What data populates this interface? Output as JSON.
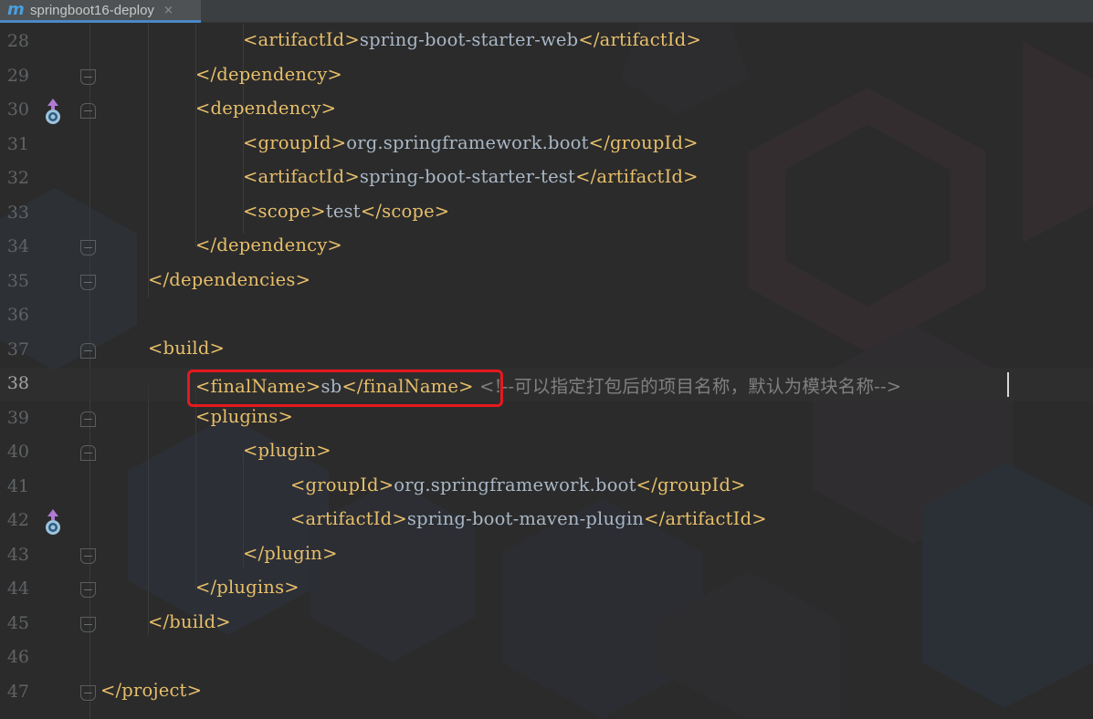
{
  "tab": {
    "icon": "m",
    "title": "springboot16-deploy",
    "close": "×"
  },
  "lines": [
    {
      "num": "28",
      "indent": 3,
      "tokens": [
        [
          "tag",
          "<artifactId>"
        ],
        [
          "txt",
          "spring-boot-starter-web"
        ],
        [
          "tag",
          "</artifactId>"
        ]
      ]
    },
    {
      "num": "29",
      "indent": 2,
      "fold": "end",
      "tokens": [
        [
          "tag",
          "</dependency>"
        ]
      ]
    },
    {
      "num": "30",
      "indent": 2,
      "fold": "start",
      "icon": true,
      "tokens": [
        [
          "tag",
          "<dependency>"
        ]
      ]
    },
    {
      "num": "31",
      "indent": 3,
      "tokens": [
        [
          "tag",
          "<groupId>"
        ],
        [
          "txt",
          "org.springframework.boot"
        ],
        [
          "tag",
          "</groupId>"
        ]
      ]
    },
    {
      "num": "32",
      "indent": 3,
      "tokens": [
        [
          "tag",
          "<artifactId>"
        ],
        [
          "txt",
          "spring-boot-starter-test"
        ],
        [
          "tag",
          "</artifactId>"
        ]
      ]
    },
    {
      "num": "33",
      "indent": 3,
      "tokens": [
        [
          "tag",
          "<scope>"
        ],
        [
          "txt",
          "test"
        ],
        [
          "tag",
          "</scope>"
        ]
      ]
    },
    {
      "num": "34",
      "indent": 2,
      "fold": "end",
      "tokens": [
        [
          "tag",
          "</dependency>"
        ]
      ]
    },
    {
      "num": "35",
      "indent": 1,
      "fold": "end",
      "tokens": [
        [
          "tag",
          "</dependencies>"
        ]
      ]
    },
    {
      "num": "36",
      "indent": 0,
      "tokens": []
    },
    {
      "num": "37",
      "indent": 1,
      "fold": "start",
      "tokens": [
        [
          "tag",
          "<build>"
        ]
      ]
    },
    {
      "num": "38",
      "indent": 2,
      "current": true,
      "tokens": [
        [
          "tag",
          "<finalName>"
        ],
        [
          "txt",
          "sb"
        ],
        [
          "tag",
          "</finalName>"
        ],
        [
          "txt",
          " "
        ],
        [
          "cmt",
          "<!--可以指定打包后的项目名称，默认为模块名称-->"
        ]
      ]
    },
    {
      "num": "39",
      "indent": 2,
      "fold": "start",
      "tokens": [
        [
          "tag",
          "<plugins>"
        ]
      ]
    },
    {
      "num": "40",
      "indent": 3,
      "fold": "start",
      "tokens": [
        [
          "tag",
          "<plugin>"
        ]
      ]
    },
    {
      "num": "41",
      "indent": 4,
      "tokens": [
        [
          "tag",
          "<groupId>"
        ],
        [
          "txt",
          "org.springframework.boot"
        ],
        [
          "tag",
          "</groupId>"
        ]
      ]
    },
    {
      "num": "42",
      "indent": 4,
      "icon": true,
      "tokens": [
        [
          "tag",
          "<artifactId>"
        ],
        [
          "txt",
          "spring-boot-maven-plugin"
        ],
        [
          "tag",
          "</artifactId>"
        ]
      ]
    },
    {
      "num": "43",
      "indent": 3,
      "fold": "end",
      "tokens": [
        [
          "tag",
          "</plugin>"
        ]
      ]
    },
    {
      "num": "44",
      "indent": 2,
      "fold": "end",
      "tokens": [
        [
          "tag",
          "</plugins>"
        ]
      ]
    },
    {
      "num": "45",
      "indent": 1,
      "fold": "end",
      "tokens": [
        [
          "tag",
          "</build>"
        ]
      ]
    },
    {
      "num": "46",
      "indent": 0,
      "tokens": []
    },
    {
      "num": "47",
      "indent": 0,
      "fold": "end",
      "tokens": [
        [
          "tag",
          "</project>"
        ]
      ]
    }
  ],
  "gutter_icon": "maven-dependency-icon",
  "highlighted_line": "38"
}
